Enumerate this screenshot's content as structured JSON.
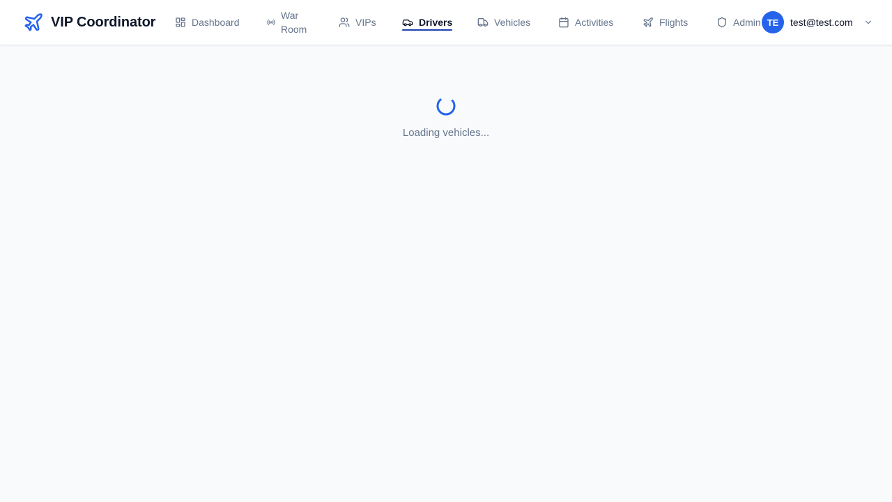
{
  "app": {
    "title": "VIP Coordinator"
  },
  "nav": {
    "items": [
      {
        "label": "Dashboard",
        "icon": "dashboard-grid-icon",
        "active": false
      },
      {
        "label": "War Room",
        "icon": "broadcast-icon",
        "active": false
      },
      {
        "label": "VIPs",
        "icon": "users-icon",
        "active": false
      },
      {
        "label": "Drivers",
        "icon": "car-icon",
        "active": true
      },
      {
        "label": "Vehicles",
        "icon": "truck-icon",
        "active": false
      },
      {
        "label": "Activities",
        "icon": "calendar-icon",
        "active": false
      },
      {
        "label": "Flights",
        "icon": "plane-icon",
        "active": false
      },
      {
        "label": "Admin",
        "icon": "shield-icon",
        "active": false
      }
    ]
  },
  "user": {
    "initials": "TE",
    "email": "test@test.com"
  },
  "main": {
    "loading_text": "Loading vehicles..."
  },
  "colors": {
    "brand": "#2563eb",
    "active_underline": "#1e40af",
    "muted_text": "#64748b",
    "background": "#f8fafc"
  }
}
